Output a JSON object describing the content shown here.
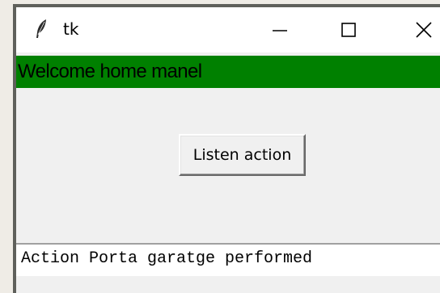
{
  "window": {
    "title": "tk",
    "icons": {
      "app": "feather-icon",
      "minimize": "minimize-icon",
      "maximize": "maximize-icon",
      "close": "close-icon"
    }
  },
  "banner": {
    "text": "Welcome home manel",
    "background": "#008000"
  },
  "main": {
    "listen_button_label": "Listen action"
  },
  "status": {
    "value": "Action Porta garatge performed"
  }
}
